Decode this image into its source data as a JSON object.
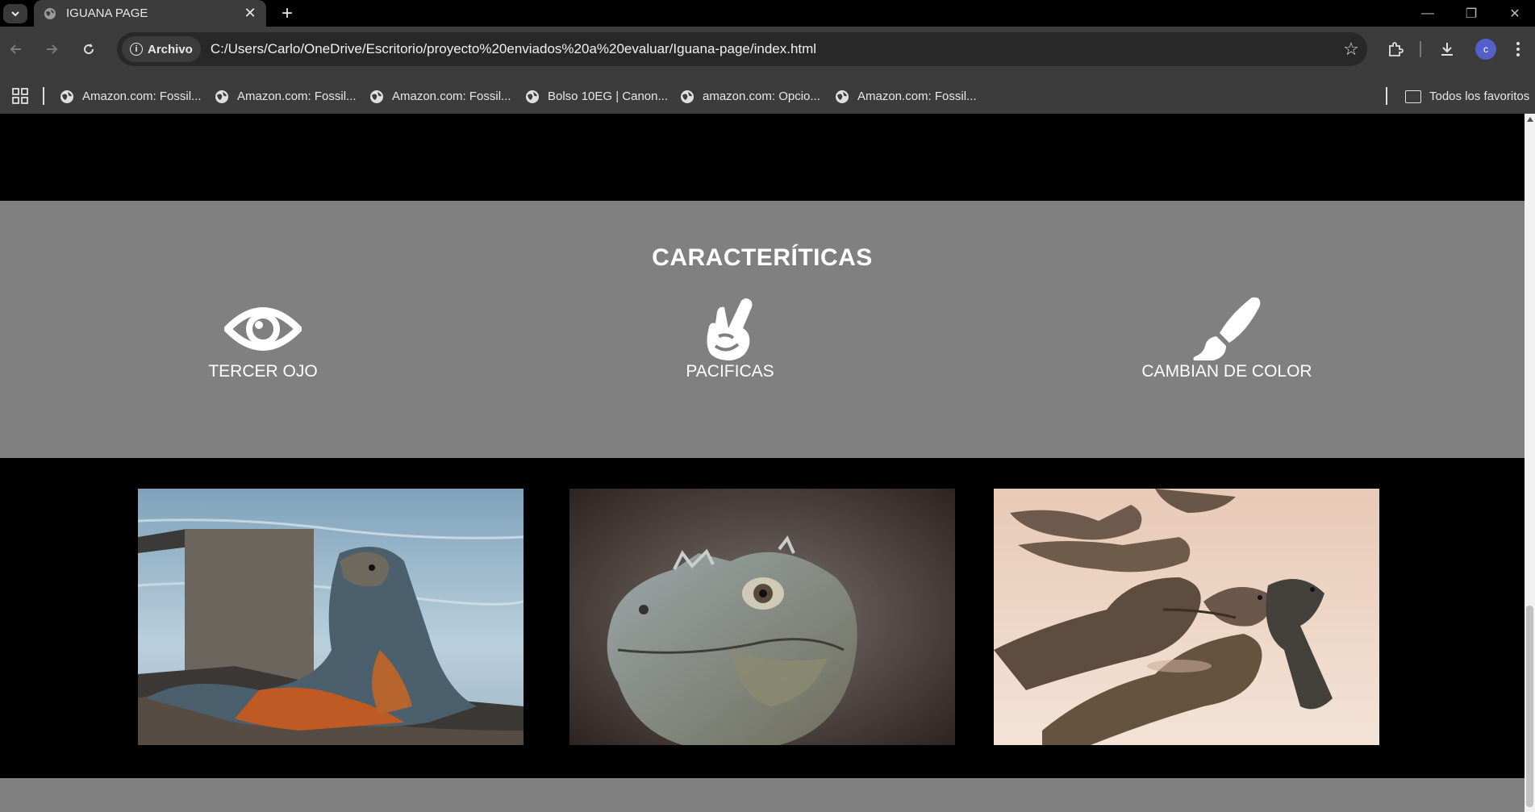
{
  "browser": {
    "tab_title": "IGUANA PAGE",
    "tab_close": "✕",
    "new_tab": "+",
    "window_controls": [
      "—",
      "❐",
      "✕"
    ],
    "security_chip": "Archivo",
    "url": "C:/Users/Carlo/OneDrive/Escritorio/proyecto%20enviados%20a%20evaluar/Iguana-page/index.html",
    "avatar_letter": "c",
    "bookmarks": [
      "Amazon.com: Fossil...",
      "Amazon.com: Fossil...",
      "Amazon.com: Fossil...",
      "Bolso 10EG | Canon...",
      "amazon.com: Opcio...",
      "Amazon.com: Fossil..."
    ],
    "all_bookmarks": "Todos los favoritos"
  },
  "page": {
    "features_title": "CARACTERÍTICAS",
    "features": [
      {
        "icon": "eye-icon",
        "label": "TERCER OJO"
      },
      {
        "icon": "peace-hand-icon",
        "label": "PACIFICAS"
      },
      {
        "icon": "paintbrush-icon",
        "label": "CAMBIAN DE COLOR"
      }
    ],
    "gallery": [
      {
        "image": "iguana-on-rocks-by-water-photo"
      },
      {
        "image": "iguana-head-closeup-photo"
      },
      {
        "image": "iguanas-group-on-sand-photo"
      }
    ],
    "colors": {
      "features_bg": "#808080",
      "page_bg": "#000000",
      "browser_chrome": "#3c3c3c"
    }
  }
}
